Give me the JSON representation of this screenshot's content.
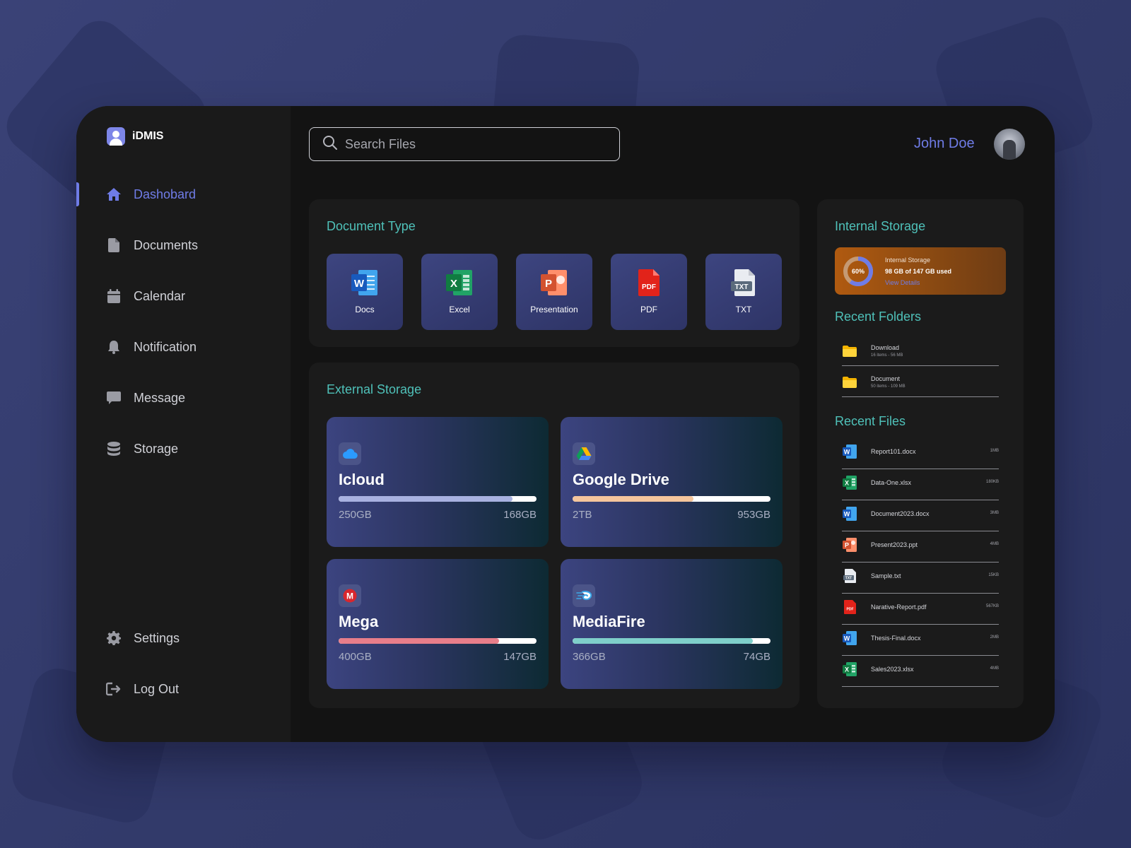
{
  "app": {
    "name": "iDMIS"
  },
  "sidebar": {
    "items": [
      {
        "label": "Dashobard",
        "icon": "home-icon",
        "active": true
      },
      {
        "label": "Documents",
        "icon": "document-icon"
      },
      {
        "label": "Calendar",
        "icon": "calendar-icon"
      },
      {
        "label": "Notification",
        "icon": "bell-icon"
      },
      {
        "label": "Message",
        "icon": "message-icon"
      },
      {
        "label": "Storage",
        "icon": "database-icon"
      }
    ],
    "bottom": [
      {
        "label": "Settings",
        "icon": "gear-icon"
      },
      {
        "label": "Log Out",
        "icon": "logout-icon"
      }
    ]
  },
  "header": {
    "search_placeholder": "Search Files",
    "user_name": "John Doe"
  },
  "document_type": {
    "title": "Document Type",
    "items": [
      {
        "label": "Docs",
        "icon": "word-icon",
        "color": "#185abd"
      },
      {
        "label": "Excel",
        "icon": "excel-icon",
        "color": "#107c41"
      },
      {
        "label": "Presentation",
        "icon": "powerpoint-icon",
        "color": "#d35230"
      },
      {
        "label": "PDF",
        "icon": "pdf-icon",
        "color": "#e2231a"
      },
      {
        "label": "TXT",
        "icon": "txt-icon",
        "color": "#5b6b7c"
      }
    ]
  },
  "external_storage": {
    "title": "External Storage",
    "items": [
      {
        "name": "Icloud",
        "total": "250GB",
        "used": "168GB",
        "usage_fraction": 0.88,
        "color": "#a8b1e0",
        "icon": "cloud-icon"
      },
      {
        "name": "Google Drive",
        "total": "2TB",
        "used": "953GB",
        "usage_fraction": 0.61,
        "color": "#f5c59c",
        "icon": "google-drive-icon"
      },
      {
        "name": "Mega",
        "total": "400GB",
        "used": "147GB",
        "usage_fraction": 0.81,
        "color": "#e87e8a",
        "icon": "mega-icon"
      },
      {
        "name": "MediaFire",
        "total": "366GB",
        "used": "74GB",
        "usage_fraction": 0.91,
        "color": "#7fcfca",
        "icon": "mediafire-icon"
      }
    ]
  },
  "internal_storage": {
    "title": "Internal Storage",
    "card_title": "Internal Storage",
    "percent_label": "60%",
    "percent": 60,
    "used_text": "98 GB of 147 GB used",
    "link": "View Details"
  },
  "recent_folders": {
    "title": "Recent Folders",
    "items": [
      {
        "name": "Download",
        "meta": "16 items - 56 MB"
      },
      {
        "name": "Document",
        "meta": "50 items - 109 MB"
      }
    ]
  },
  "recent_files": {
    "title": "Recent Files",
    "items": [
      {
        "name": "Report101.docx",
        "size": "1MB",
        "type": "word"
      },
      {
        "name": "Data-One.xlsx",
        "size": "180KB",
        "type": "excel"
      },
      {
        "name": "Document2023.docx",
        "size": "3MB",
        "type": "word"
      },
      {
        "name": "Present2023.ppt",
        "size": "4MB",
        "type": "powerpoint"
      },
      {
        "name": "Sample.txt",
        "size": "15KB",
        "type": "txt"
      },
      {
        "name": "Narative-Report.pdf",
        "size": "567KB",
        "type": "pdf"
      },
      {
        "name": "Thesis-Final.docx",
        "size": "2MB",
        "type": "word"
      },
      {
        "name": "Sales2023.xlsx",
        "size": "4MB",
        "type": "excel"
      }
    ]
  }
}
